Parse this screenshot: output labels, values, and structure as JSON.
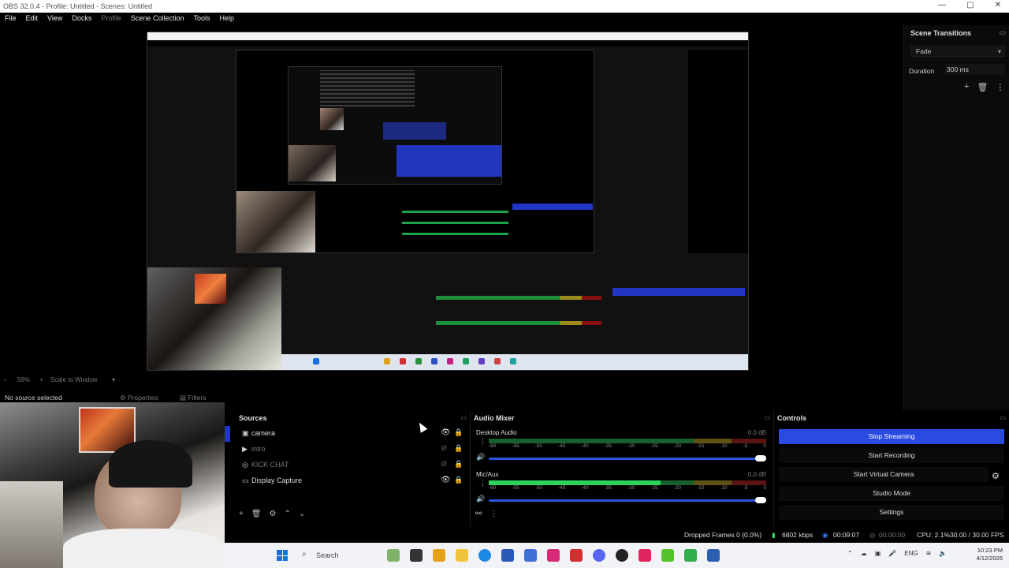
{
  "window": {
    "title": "OBS 32.0.4 - Profile: Untitled - Scenes: Untitled",
    "controls": [
      "—",
      "▢",
      "✕"
    ]
  },
  "menu": [
    "File",
    "Edit",
    "View",
    "Docks",
    "Profile",
    "Scene Collection",
    "Tools",
    "Help"
  ],
  "scene_transitions": {
    "title": "Scene Transitions",
    "transition": "Fade",
    "duration_label": "Duration",
    "duration_value": "300 ms"
  },
  "preview": {
    "zoom": "59%",
    "scale_mode": "Scale to Window"
  },
  "selection_bar": {
    "no_source": "No source selected",
    "properties": "Properties",
    "filters": "Filters"
  },
  "sources": {
    "title": "Sources",
    "items": [
      {
        "label": "camera",
        "icon": "camera-icon",
        "visible": true,
        "locked": true,
        "selected": true,
        "dim": false
      },
      {
        "label": "intro",
        "icon": "play-icon",
        "visible": false,
        "locked": true,
        "selected": false,
        "dim": true
      },
      {
        "label": "KICK CHAT",
        "icon": "globe-icon",
        "visible": false,
        "locked": true,
        "selected": false,
        "dim": true
      },
      {
        "label": "Display Capture",
        "icon": "monitor-icon",
        "visible": true,
        "locked": true,
        "selected": false,
        "dim": false
      }
    ]
  },
  "audio_mixer": {
    "title": "Audio Mixer",
    "ticks": [
      "-60",
      "-55",
      "-50",
      "-45",
      "-40",
      "-35",
      "-30",
      "-25",
      "-20",
      "-15",
      "-10",
      "-5",
      "0"
    ],
    "channels": [
      {
        "name": "Desktop Audio",
        "db": "0.0 dB",
        "level": 0.0
      },
      {
        "name": "Mic/Aux",
        "db": "0.0 dB",
        "level": 0.62
      }
    ]
  },
  "controls": {
    "title": "Controls",
    "stop_streaming": "Stop Streaming",
    "start_recording": "Start Recording",
    "start_virtual_camera": "Start Virtual Camera",
    "studio_mode": "Studio Mode",
    "settings": "Settings"
  },
  "status": {
    "dropped_frames": "Dropped Frames 0 (0.0%)",
    "bitrate": "6802 kbps",
    "stream_time": "00:09:07",
    "rec_time": "00:00:00",
    "cpu": "CPU: 2.1%",
    "fps": "30.00 / 30.00 FPS"
  },
  "taskbar": {
    "search": "Search",
    "lang": "ENG",
    "time": "10:23 PM",
    "date": "4/12/2026"
  },
  "colors": {
    "accent": "#2a4be2",
    "meter_green": "#2bd35a"
  }
}
